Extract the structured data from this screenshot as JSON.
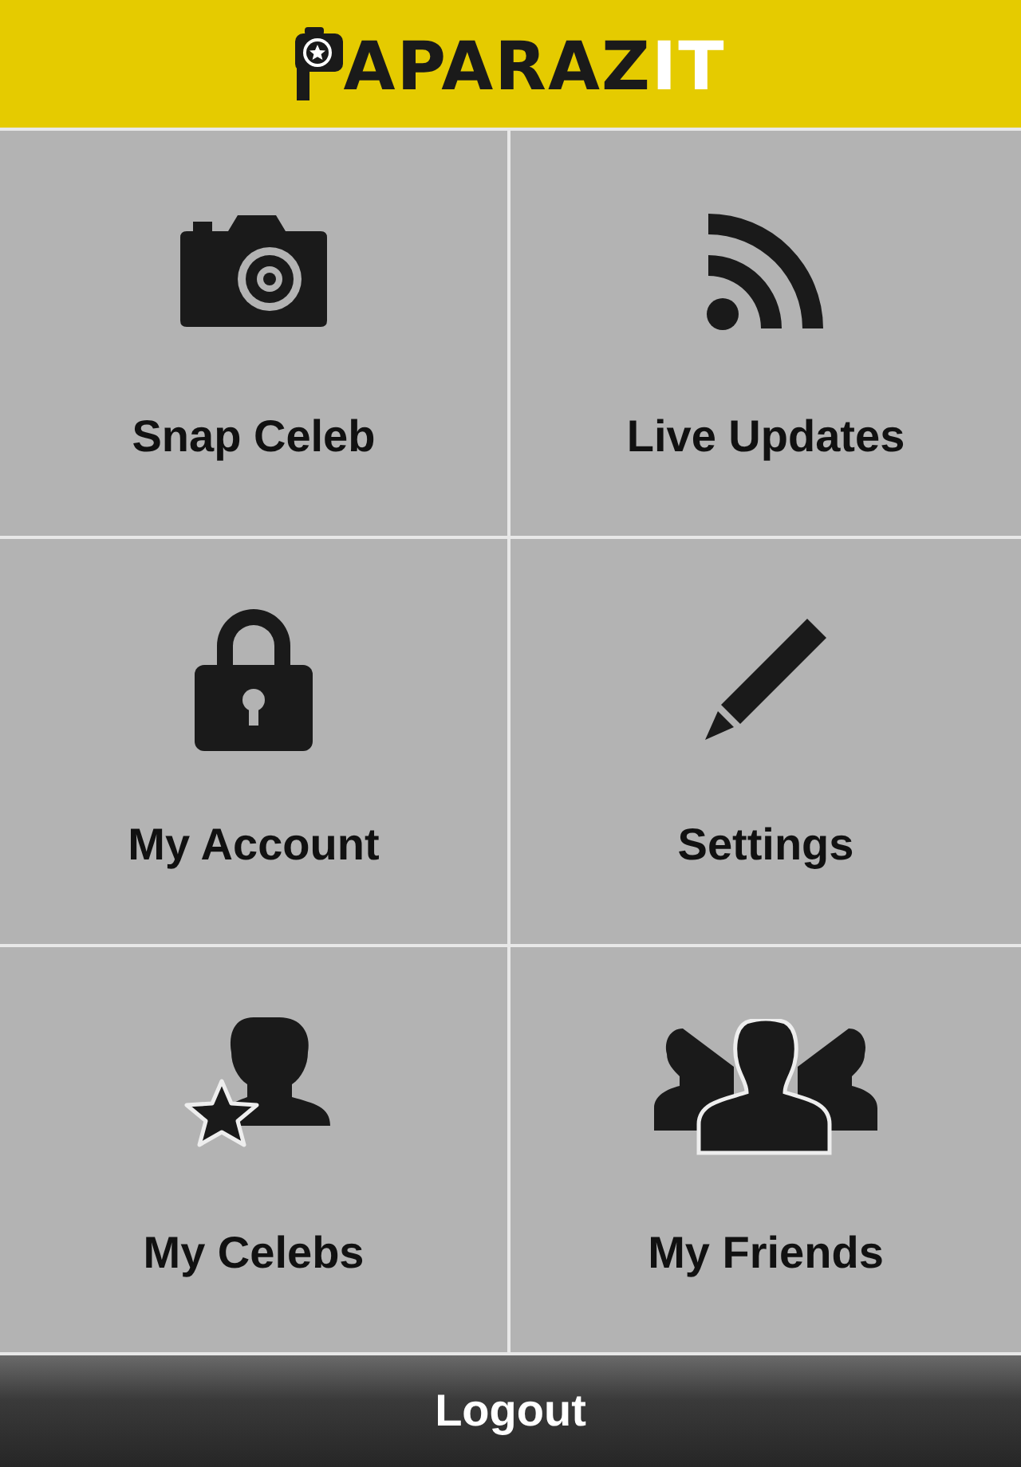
{
  "header": {
    "logo_dark": "APARAZ",
    "logo_light": "IT"
  },
  "tiles": [
    {
      "kind": "camera",
      "label": "Snap Celeb"
    },
    {
      "kind": "feed",
      "label": "Live Updates"
    },
    {
      "kind": "lock",
      "label": "My Account"
    },
    {
      "kind": "pencil",
      "label": "Settings"
    },
    {
      "kind": "celeb",
      "label": "My Celebs"
    },
    {
      "kind": "friends",
      "label": "My Friends"
    }
  ],
  "footer": {
    "button": "Logout"
  }
}
